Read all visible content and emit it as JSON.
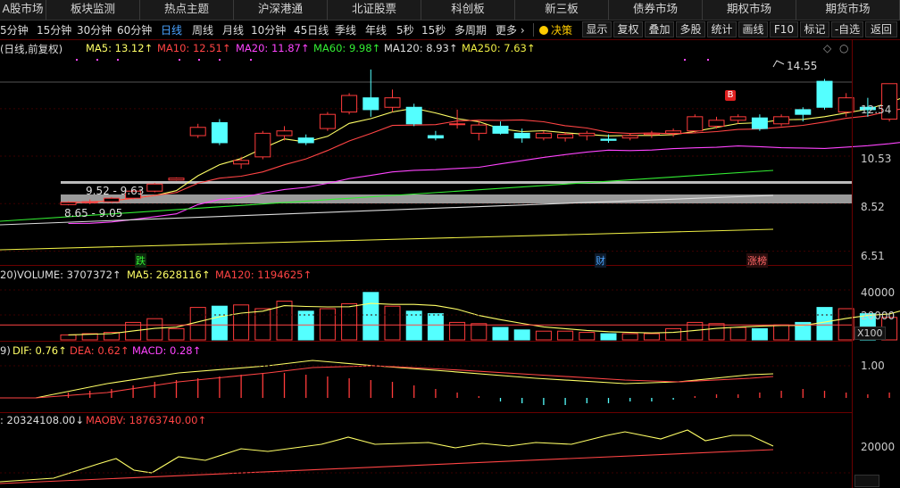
{
  "topnav": {
    "tabs": [
      "A股市场",
      "板块监测",
      "热点主题",
      "沪深港通",
      "北证股票",
      "科创板",
      "新三板",
      "债券市场",
      "期权市场",
      "期货市场"
    ]
  },
  "periodbar": {
    "periods": [
      "5分钟",
      "15分钟",
      "30分钟",
      "60分钟",
      "日线",
      "周线",
      "月线",
      "10分钟",
      "45日线",
      "季线",
      "年线",
      "5秒",
      "15秒",
      "多周期",
      "更多 ›"
    ],
    "active_period": "日线",
    "tools": {
      "decision": "决策",
      "display": "显示",
      "restore": "复权",
      "overlay": "叠加",
      "multi": "多股",
      "stats": "统计",
      "draw": "画线",
      "f10": "F10",
      "mark": "标记",
      "add_watch": "-自选",
      "back": "返回"
    }
  },
  "main_legend": {
    "prefix": "(日线,前复权)",
    "ma5": "MA5: 13.12↑",
    "ma10": "MA10: 12.51↑",
    "ma20": "MA20: 11.87↑",
    "ma60": "MA60: 9.98↑",
    "ma120": "MA120: 8.93↑",
    "ma250": "MA250: 7.63↑"
  },
  "main_annotations": {
    "high_label": "14.55",
    "zone_upper": "9.52 - 9.63",
    "zone_lower": "8.65 - 9.05",
    "event_die": "跌",
    "event_cai": "财",
    "event_zhangting": "涨榜",
    "buy_marker": "B"
  },
  "main_yaxis": [
    "12.54",
    "10.53",
    "8.52",
    "6.51"
  ],
  "volume_legend": {
    "prefix": "20)",
    "volume": "VOLUME: 3707372↑",
    "ma5": "MA5: 2628116↑",
    "ma120": "MA120: 1194625↑"
  },
  "volume_yaxis": [
    "40000",
    "20000"
  ],
  "volume_unit": "X100",
  "macd_legend": {
    "prefix": "9)",
    "dif": "DIF: 0.76↑",
    "dea": "DEA: 0.62↑",
    "macd": "MACD: 0.28↑"
  },
  "macd_yaxis": [
    "1.00"
  ],
  "obv_legend": {
    "obv": ": 20324108.00↓",
    "maobv": "MAOBV: 18763740.00↑"
  },
  "obv_yaxis": [
    "20000"
  ],
  "colors": {
    "up": "#ff3b3b",
    "down": "#54ffff",
    "ma5": "#ffff66",
    "ma10": "#ff4444",
    "ma20": "#ff44ff",
    "ma60": "#33ee33",
    "ma120": "#dddddd",
    "ma250": "#eeee44",
    "decision": "#ffcc00",
    "active_period": "#4aa3ff"
  },
  "chart_data": {
    "type": "candlestick",
    "candles_ohlc": [
      [
        8.48,
        8.62,
        8.45,
        8.58
      ],
      [
        8.58,
        8.7,
        8.5,
        8.6
      ],
      [
        8.6,
        8.8,
        8.55,
        8.75
      ],
      [
        8.75,
        9.1,
        8.7,
        9.05
      ],
      [
        9.05,
        9.4,
        9.0,
        9.35
      ],
      [
        9.52,
        9.63,
        9.5,
        9.6
      ],
      [
        11.4,
        11.9,
        11.3,
        11.75
      ],
      [
        11.95,
        12.1,
        11.0,
        11.1
      ],
      [
        10.2,
        10.5,
        10.0,
        10.35
      ],
      [
        10.5,
        11.6,
        10.4,
        11.5
      ],
      [
        11.4,
        11.8,
        11.2,
        11.6
      ],
      [
        11.3,
        11.45,
        11.0,
        11.1
      ],
      [
        11.7,
        12.4,
        11.6,
        12.3
      ],
      [
        12.4,
        13.2,
        12.3,
        13.1
      ],
      [
        13.0,
        14.2,
        12.2,
        12.5
      ],
      [
        12.6,
        13.35,
        12.4,
        13.0
      ],
      [
        12.6,
        12.75,
        11.8,
        11.9
      ],
      [
        11.4,
        11.6,
        11.2,
        11.3
      ],
      [
        11.9,
        12.5,
        11.7,
        11.9
      ],
      [
        11.5,
        12.0,
        11.2,
        11.85
      ],
      [
        11.8,
        12.0,
        11.45,
        11.5
      ],
      [
        11.5,
        11.7,
        11.1,
        11.3
      ],
      [
        11.3,
        11.6,
        11.2,
        11.5
      ],
      [
        11.3,
        11.55,
        11.15,
        11.45
      ],
      [
        11.4,
        11.6,
        11.2,
        11.5
      ],
      [
        11.25,
        11.45,
        11.1,
        11.2
      ],
      [
        11.3,
        11.5,
        11.2,
        11.4
      ],
      [
        11.45,
        11.6,
        11.3,
        11.5
      ],
      [
        11.5,
        11.7,
        11.35,
        11.6
      ],
      [
        11.6,
        12.3,
        11.5,
        12.2
      ],
      [
        11.8,
        12.2,
        11.7,
        12.05
      ],
      [
        12.05,
        12.3,
        11.9,
        12.2
      ],
      [
        12.15,
        12.3,
        11.6,
        11.7
      ],
      [
        11.9,
        12.3,
        11.8,
        12.2
      ],
      [
        12.5,
        12.6,
        12.0,
        12.3
      ],
      [
        13.7,
        13.8,
        12.5,
        12.6
      ],
      [
        12.4,
        13.2,
        12.2,
        13.0
      ],
      [
        12.6,
        13.0,
        12.2,
        12.5
      ],
      [
        12.1,
        13.0,
        12.0,
        13.6
      ],
      [
        13.5,
        14.55,
        13.4,
        14.0
      ]
    ],
    "volume": [
      4,
      5,
      6,
      14,
      17,
      9,
      26,
      27,
      28,
      25,
      31,
      23,
      25,
      29,
      38,
      27,
      23,
      21,
      14,
      13,
      10,
      8,
      7,
      7,
      6,
      5,
      5,
      5,
      9,
      14,
      13,
      10,
      9,
      12,
      14,
      26,
      25,
      21,
      18,
      37
    ],
    "volume_unit": "X100",
    "yrange_main": [
      6.0,
      14.8
    ],
    "yticks_main": [
      12.54,
      10.53,
      8.52,
      6.51
    ]
  }
}
